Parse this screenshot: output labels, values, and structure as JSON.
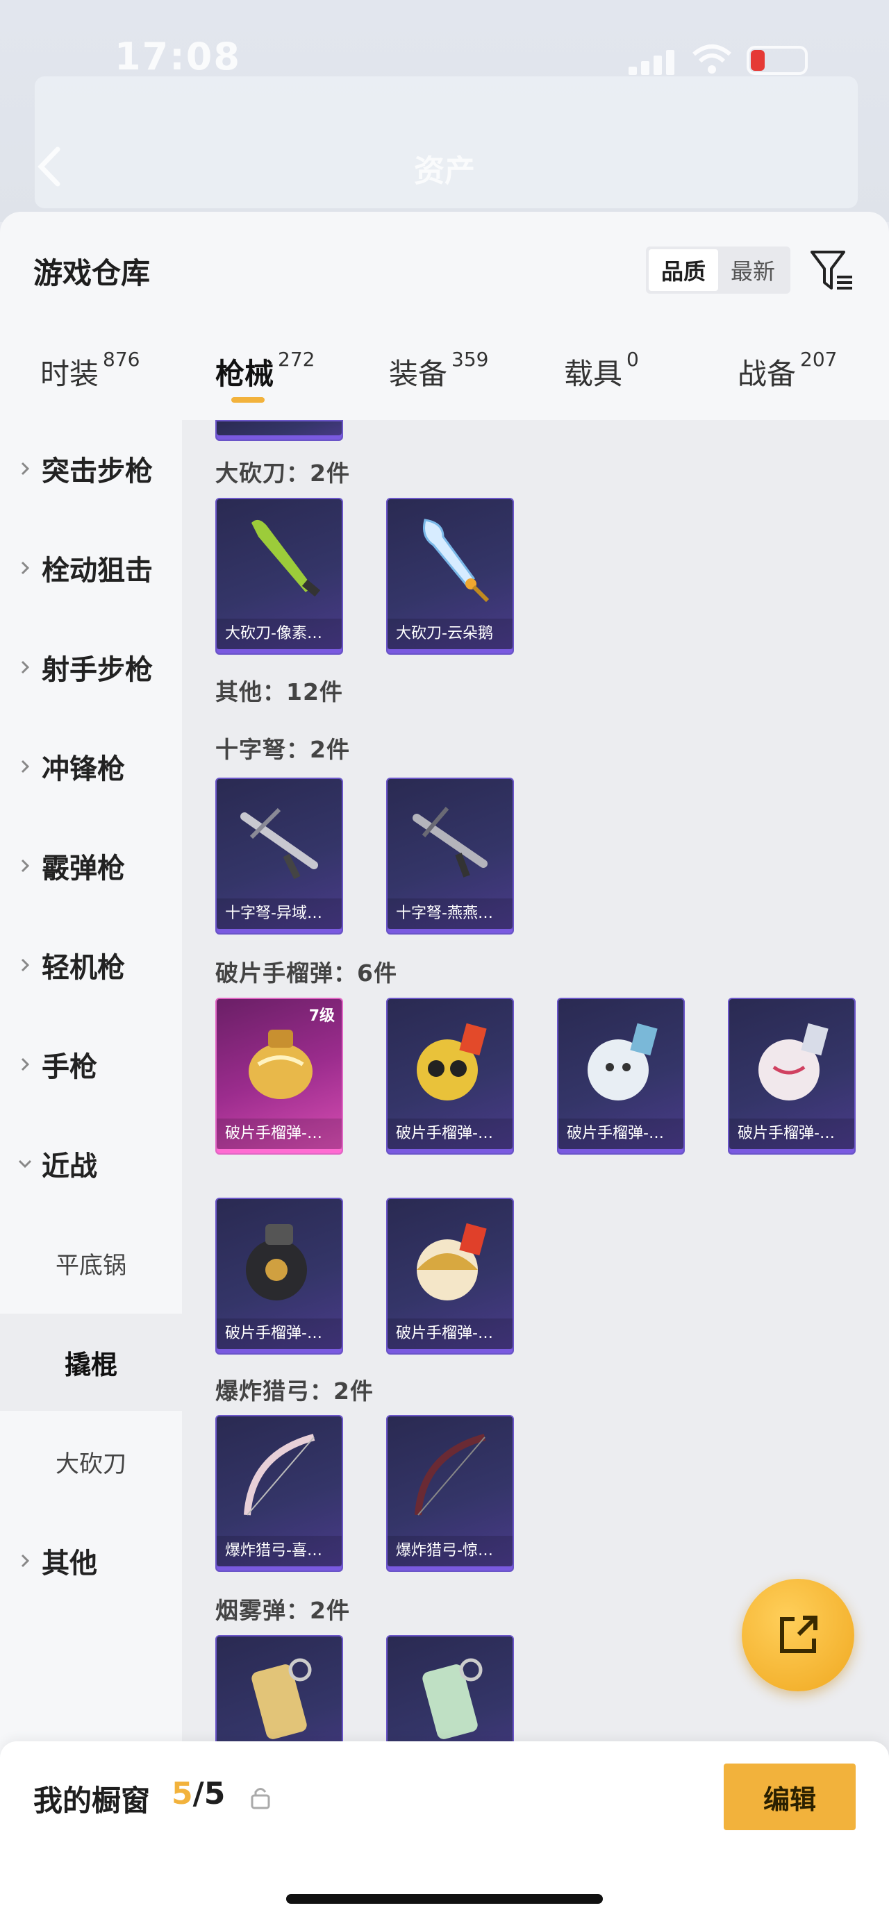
{
  "status": {
    "time": "17:08"
  },
  "nav": {
    "title": "资产"
  },
  "sheet": {
    "title": "游戏仓库",
    "sort": {
      "quality": "品质",
      "newest": "最新"
    }
  },
  "tabs": [
    {
      "label": "时装",
      "count": "876"
    },
    {
      "label": "枪械",
      "count": "272"
    },
    {
      "label": "装备",
      "count": "359"
    },
    {
      "label": "载具",
      "count": "0"
    },
    {
      "label": "战备",
      "count": "207"
    }
  ],
  "sidebar": {
    "categories": [
      "突击步枪",
      "栓动狙击",
      "射手步枪",
      "冲锋枪",
      "霰弹枪",
      "轻机枪",
      "手枪",
      "近战",
      "其他"
    ],
    "melee_subs": [
      "平底锅",
      "撬棍",
      "大砍刀"
    ]
  },
  "sections": {
    "machete": {
      "title": "大砍刀：2件",
      "items": [
        "大砍刀-像素…",
        "大砍刀-云朵鹅"
      ]
    },
    "other": {
      "title": "其他：12件"
    },
    "crossbow": {
      "title": "十字弩：2件",
      "items": [
        "十字弩-异域…",
        "十字弩-燕燕…"
      ]
    },
    "grenade": {
      "title": "破片手榴弹：6件",
      "level": "7级",
      "items": [
        "破片手榴弹-…",
        "破片手榴弹-…",
        "破片手榴弹-…",
        "破片手榴弹-…",
        "破片手榴弹-…",
        "破片手榴弹-…"
      ]
    },
    "bow": {
      "title": "爆炸猎弓：2件",
      "items": [
        "爆炸猎弓-喜…",
        "爆炸猎弓-惊…"
      ]
    },
    "smoke": {
      "title": "烟雾弹：2件"
    }
  },
  "showcase": {
    "label": "我的橱窗",
    "current": "5",
    "total": "/5",
    "edit": "编辑"
  },
  "colors": {
    "accent": "#f2b23c",
    "card_purple": "#343568",
    "card_pink": "#9b2c8d"
  }
}
